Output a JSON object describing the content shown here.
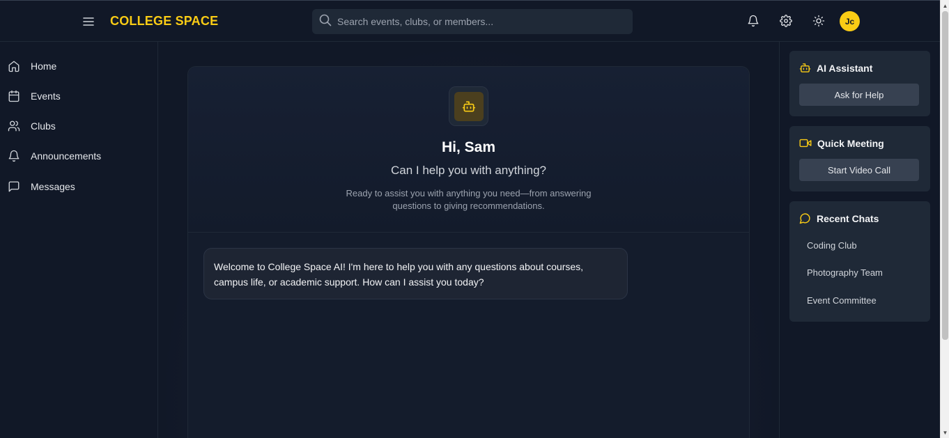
{
  "header": {
    "brand": "COLLEGE SPACE",
    "search_placeholder": "Search events, clubs, or members...",
    "avatar_initials": "Jc"
  },
  "sidebar": {
    "items": [
      {
        "label": "Home",
        "icon": "home-icon"
      },
      {
        "label": "Events",
        "icon": "calendar-icon"
      },
      {
        "label": "Clubs",
        "icon": "users-icon"
      },
      {
        "label": "Announcements",
        "icon": "bell-icon"
      },
      {
        "label": "Messages",
        "icon": "message-icon"
      }
    ]
  },
  "main": {
    "greeting": "Hi, Sam",
    "subtitle": "Can I help you with anything?",
    "description": "Ready to assist you with anything you need—from answering questions to giving recommendations.",
    "message": "Welcome to College Space AI! I'm here to help you with any questions about courses, campus life, or academic support. How can I assist you today?"
  },
  "right": {
    "ai_assistant": {
      "title": "AI Assistant",
      "button": "Ask for Help"
    },
    "quick_meeting": {
      "title": "Quick Meeting",
      "button": "Start Video Call"
    },
    "recent_chats": {
      "title": "Recent Chats",
      "items": [
        "Coding Club",
        "Photography Team",
        "Event Committee"
      ]
    }
  },
  "colors": {
    "accent": "#facc15",
    "background": "#111827",
    "card": "#1f2937"
  }
}
